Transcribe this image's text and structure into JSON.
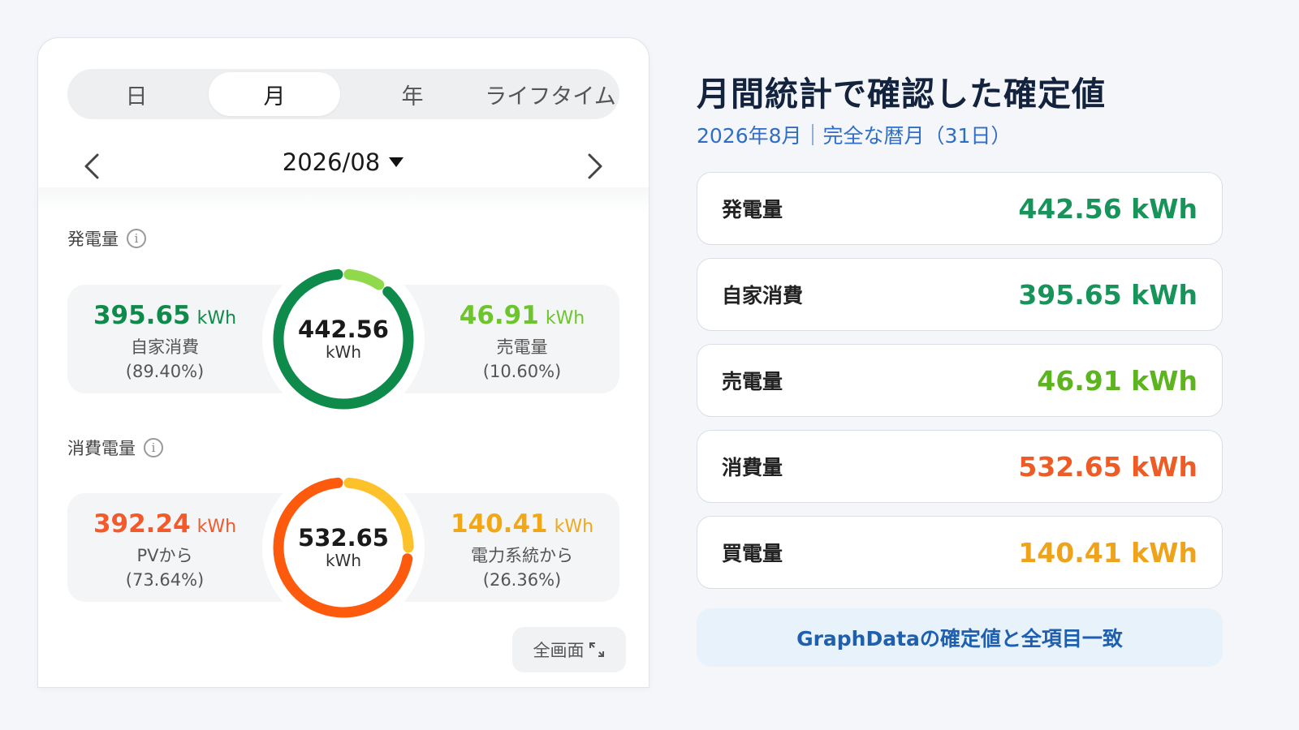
{
  "app": {
    "tabs": [
      {
        "label": "日",
        "active": false
      },
      {
        "label": "月",
        "active": true
      },
      {
        "label": "年",
        "active": false
      },
      {
        "label": "ライフタイム",
        "active": false
      }
    ],
    "period": "2026/08",
    "icons": {
      "prev": "chevron-left-icon",
      "next": "chevron-right-icon",
      "dropdown": "caret-down-icon",
      "info": "info-icon",
      "expand": "expand-icon"
    },
    "generation": {
      "section_label": "発電量",
      "left": {
        "value": "395.65",
        "unit": "kWh",
        "label": "自家消費",
        "percent": "(89.40%)",
        "color": "#0e8a4a"
      },
      "right": {
        "value": "46.91",
        "unit": "kWh",
        "label": "売電量",
        "percent": "(10.60%)",
        "color": "#6cc52a"
      },
      "center": {
        "value": "442.56",
        "unit": "kWh"
      },
      "ring": {
        "primary_fraction": 0.894,
        "primary_color": "#0e8a4a",
        "secondary_color": "#8fd94a"
      }
    },
    "consumption": {
      "section_label": "消費電量",
      "left": {
        "value": "392.24",
        "unit": "kWh",
        "label": "PVから",
        "percent": "(73.64%)",
        "color": "#f25a2b"
      },
      "right": {
        "value": "140.41",
        "unit": "kWh",
        "label": "電力系統から",
        "percent": "(26.36%)",
        "color": "#f0a818"
      },
      "center": {
        "value": "532.65",
        "unit": "kWh"
      },
      "ring": {
        "primary_fraction": 0.7364,
        "primary_color": "#fe5a0e",
        "secondary_color": "#fdc12a"
      }
    },
    "fullscreen_label": "全画面"
  },
  "summary": {
    "title": "月間統計で確認した確定値",
    "subtitle_period": "2026年8月",
    "subtitle_note": "完全な暦月（31日）",
    "metrics": [
      {
        "label": "発電量",
        "value": "442.56 kWh",
        "color": "#17945a"
      },
      {
        "label": "自家消費",
        "value": "395.65 kWh",
        "color": "#17945a"
      },
      {
        "label": "売電量",
        "value": "46.91 kWh",
        "color": "#5cb51e"
      },
      {
        "label": "消費量",
        "value": "532.65 kWh",
        "color": "#ee5b24"
      },
      {
        "label": "買電量",
        "value": "140.41 kWh",
        "color": "#eea31a"
      }
    ],
    "banner": "GraphDataの確定値と全項目一致"
  }
}
